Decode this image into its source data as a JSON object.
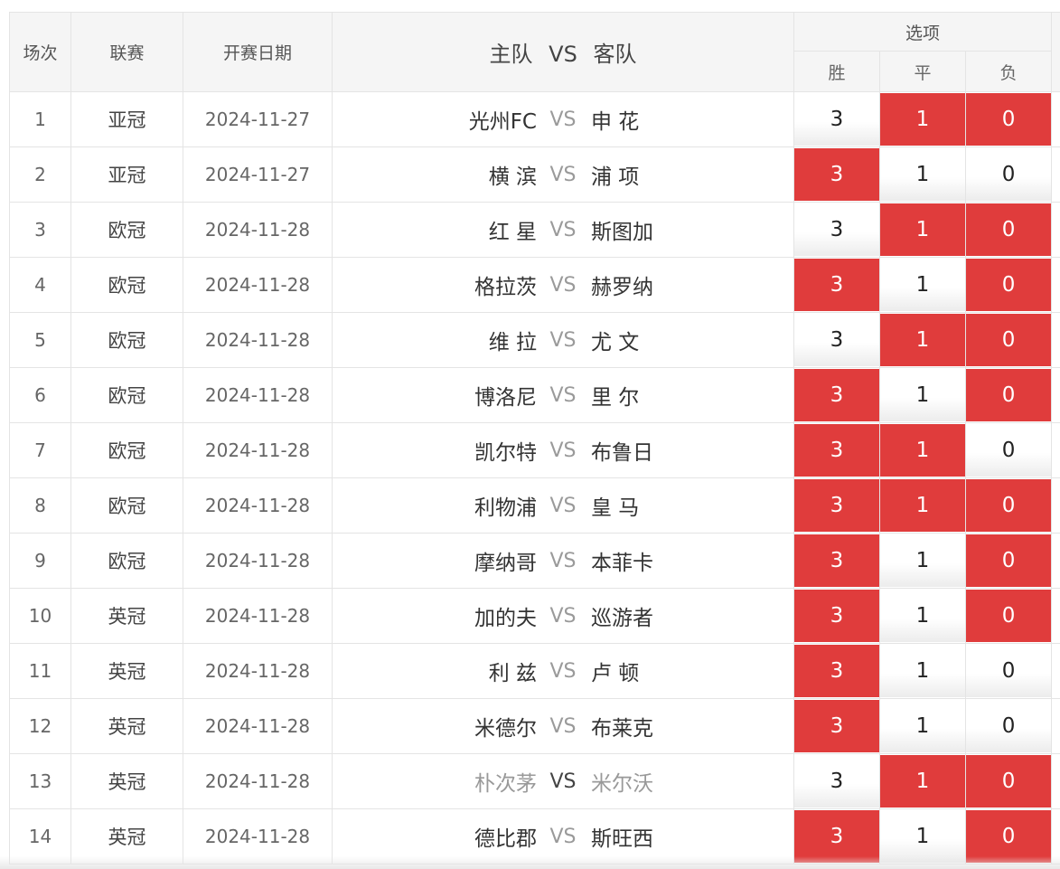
{
  "header": {
    "idx": "场次",
    "league": "联赛",
    "date": "开赛日期",
    "home": "主队",
    "vs": "VS",
    "away": "客队",
    "options": "选项",
    "win": "胜",
    "draw": "平",
    "lose": "负"
  },
  "colors": {
    "selected": "#e03c3c",
    "header_bg": "#f5f5f5",
    "border": "#e4e4e4"
  },
  "vs_label": "VS",
  "rows": [
    {
      "idx": "1",
      "league": "亚冠",
      "date": "2024-11-27",
      "home": "光州FC",
      "away": "申 花",
      "win": "3",
      "draw": "1",
      "lose": "0",
      "sel": [
        false,
        true,
        true
      ]
    },
    {
      "idx": "2",
      "league": "亚冠",
      "date": "2024-11-27",
      "home": "横 滨",
      "away": "浦 项",
      "win": "3",
      "draw": "1",
      "lose": "0",
      "sel": [
        true,
        false,
        false
      ]
    },
    {
      "idx": "3",
      "league": "欧冠",
      "date": "2024-11-28",
      "home": "红 星",
      "away": "斯图加",
      "win": "3",
      "draw": "1",
      "lose": "0",
      "sel": [
        false,
        true,
        true
      ]
    },
    {
      "idx": "4",
      "league": "欧冠",
      "date": "2024-11-28",
      "home": "格拉茨",
      "away": "赫罗纳",
      "win": "3",
      "draw": "1",
      "lose": "0",
      "sel": [
        true,
        false,
        true
      ]
    },
    {
      "idx": "5",
      "league": "欧冠",
      "date": "2024-11-28",
      "home": "维 拉",
      "away": "尤 文",
      "win": "3",
      "draw": "1",
      "lose": "0",
      "sel": [
        false,
        true,
        true
      ]
    },
    {
      "idx": "6",
      "league": "欧冠",
      "date": "2024-11-28",
      "home": "博洛尼",
      "away": "里 尔",
      "win": "3",
      "draw": "1",
      "lose": "0",
      "sel": [
        true,
        false,
        true
      ]
    },
    {
      "idx": "7",
      "league": "欧冠",
      "date": "2024-11-28",
      "home": "凯尔特",
      "away": "布鲁日",
      "win": "3",
      "draw": "1",
      "lose": "0",
      "sel": [
        true,
        true,
        false
      ]
    },
    {
      "idx": "8",
      "league": "欧冠",
      "date": "2024-11-28",
      "home": "利物浦",
      "away": "皇 马",
      "win": "3",
      "draw": "1",
      "lose": "0",
      "sel": [
        true,
        true,
        true
      ]
    },
    {
      "idx": "9",
      "league": "欧冠",
      "date": "2024-11-28",
      "home": "摩纳哥",
      "away": "本菲卡",
      "win": "3",
      "draw": "1",
      "lose": "0",
      "sel": [
        true,
        false,
        true
      ]
    },
    {
      "idx": "10",
      "league": "英冠",
      "date": "2024-11-28",
      "home": "加的夫",
      "away": "巡游者",
      "win": "3",
      "draw": "1",
      "lose": "0",
      "sel": [
        true,
        false,
        true
      ]
    },
    {
      "idx": "11",
      "league": "英冠",
      "date": "2024-11-28",
      "home": "利 兹",
      "away": "卢 顿",
      "win": "3",
      "draw": "1",
      "lose": "0",
      "sel": [
        true,
        false,
        false
      ]
    },
    {
      "idx": "12",
      "league": "英冠",
      "date": "2024-11-28",
      "home": "米德尔",
      "away": "布莱克",
      "win": "3",
      "draw": "1",
      "lose": "0",
      "sel": [
        true,
        false,
        false
      ]
    },
    {
      "idx": "13",
      "league": "英冠",
      "date": "2024-11-28",
      "home": "朴次茅",
      "away": "米尔沃",
      "win": "3",
      "draw": "1",
      "lose": "0",
      "sel": [
        false,
        true,
        true
      ],
      "muted": true
    },
    {
      "idx": "14",
      "league": "英冠",
      "date": "2024-11-28",
      "home": "德比郡",
      "away": "斯旺西",
      "win": "3",
      "draw": "1",
      "lose": "0",
      "sel": [
        true,
        false,
        true
      ]
    }
  ]
}
